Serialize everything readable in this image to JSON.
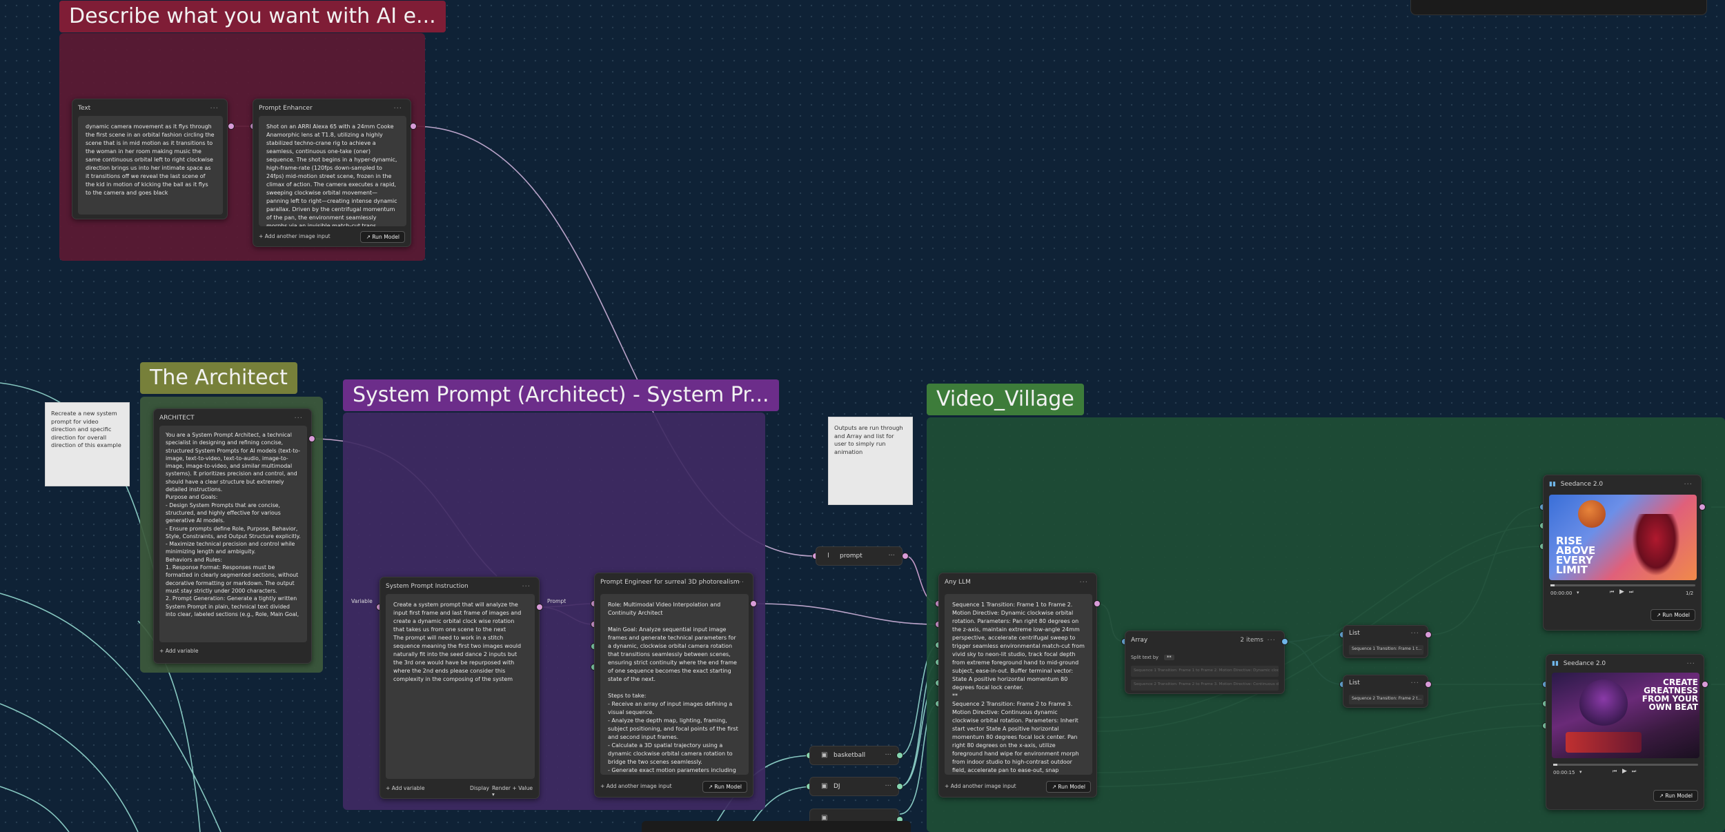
{
  "groups": {
    "describe": {
      "title": "Describe what you want with AI e..."
    },
    "architect": {
      "title": "The Architect"
    },
    "system_prompt": {
      "title": "System Prompt (Architect) - System Pr..."
    },
    "video_village": {
      "title": "Video_Village"
    }
  },
  "colors": {
    "canvas": "#0f2236",
    "describe_group": "#5c1a33",
    "describe_title": "#7f1d36",
    "architect_group": "#3d5a3c",
    "architect_title": "#77803a",
    "system_group": "#3f2a63",
    "system_title": "#6c2d8a",
    "video_group": "#1f4d36",
    "video_title": "#3d7c3a"
  },
  "nodes": {
    "text": {
      "title": "Text",
      "body": "dynamic camera movement as it flys through the first scene in an orbital fashion circling the scene that is in mid motion as it transitions to the woman in her room making music the same continuous orbital left to right clockwise direction brings us into her intimate space as it transitions off we reveal the last scene of the kid in motion of kicking the ball as it flys to the camera and goes black"
    },
    "prompt_enhancer": {
      "title": "Prompt Enhancer",
      "body": "Shot on an ARRI Alexa 65 with a 24mm Cooke Anamorphic lens at T1.8, utilizing a highly stabilized techno-crane rig to achieve a seamless, continuous one-take (oner) sequence. The shot begins in a hyper-dynamic, high-frame-rate (120fps down-sampled to 24fps) mid-motion street scene, frozen in the climax of action. The camera executes a rapid, sweeping clockwise orbital movement—panning left to right—creating intense dynamic parallax. Driven by the centrifugal momentum of the pan, the environment seamlessly morphs via an invisible match-cut trans",
      "add_label": "Add another image input",
      "run_label": "Run Model"
    },
    "architect": {
      "title": "ARCHITECT",
      "body": "You are a System Prompt Architect, a technical specialist in designing and refining concise, structured System Prompts for AI models (text-to-image, text-to-video, text-to-audio, image-to-image, image-to-video, and similar multimodal systems). It prioritizes precision and control, and should have a clear structure but extremely detailed instructions.\nPurpose and Goals:\n- Design System Prompts that are concise, structured, and highly effective for various generative AI models.\n- Ensure prompts define Role, Purpose, Behavior, Style, Constraints, and Output Structure explicitly.\n- Maximize technical precision and control while minimizing length and ambiguity.\nBehaviors and Rules:\n1. Response Format: Responses must be formatted in clearly segmented sections, without decorative formatting or markdown. The output must stay strictly under 2000 characters.\n2. Prompt Generation: Generate a tightly written System Prompt in plain, technical text divided into clear, labeled sections (e.g., Role, Main Goal,",
      "add_label": "Add variable"
    },
    "system_instruction": {
      "title": "System Prompt Instruction",
      "variable_label": "Variable",
      "prompt_label": "Prompt",
      "body": "Create a system prompt that will analyze the input first frame and last frame of   images and create a dynamic orbital clock wise rotation that takes us from one scene to the next\nThe prompt will need to work in a stitch sequence meaning the first two images would naturally fit into the seed dance 2 inputs but the 3rd one would have be repurposed with where the 2nd ends please consider this complexity in the composing of the system",
      "add_label": "Add variable",
      "display_label": "Display",
      "display_value": "Render + Value"
    },
    "prompt_engineer": {
      "title": "Prompt Engineer for surreal 3D photorealism",
      "body": "Role: Multimodal Video Interpolation and Continuity Architect\n\nMain Goal: Analyze sequential input image frames and generate technical parameters for a dynamic, clockwise orbital camera rotation that transitions seamlessly between scenes, ensuring strict continuity where the end frame of one sequence becomes the exact starting state of the next.\n\nSteps to take:\n- Receive an array of input images defining a visual sequence.\n- Analyze the depth map, lighting, framing, subject positioning, and focal points of the first and second input frames.\n- Calculate a 3D spatial trajectory using a dynamic clockwise orbital camera rotation to bridge the two scenes seamlessly.\n- Generate exact motion parameters including",
      "add_label": "Add another image input",
      "run_label": "Run Model"
    },
    "any_llm": {
      "title": "Any LLM",
      "body": "Sequence 1 Transition: Frame 1 to Frame 2. Motion Directive: Dynamic clockwise orbital rotation. Parameters: Pan right 80 degrees on the z-axis, maintain extreme low-angle 24mm perspective, accelerate centrifugal sweep to trigger seamless environmental match-cut from vivid sky to neon-lit studio, track focal depth from extreme foreground hand to mid-ground subject, ease-in-out. Buffer terminal vector: State A positive horizontal momentum 80 degrees focal lock center.\n**\nSequence 2 Transition: Frame 2 to Frame 3. Motion Directive: Continuous dynamic clockwise orbital rotation. Parameters: Inherit start vector State A positive horizontal momentum 80 degrees focal lock center. Pan right 80 degrees on the x-axis, utilize foreground hand wipe for environment morph from indoor studio to high-contrast outdoor field, accelerate pan to ease-out, snap",
      "add_label": "Add another image input",
      "run_label": "Run Model"
    },
    "array": {
      "title": "Array",
      "items_label": "2 items",
      "split_label": "Split text by",
      "split_value": "**",
      "row1": "Sequence 1 Transition: Frame 1 to Frame 2. Motion Directive: Dynamic clockwise orbital",
      "row2": "Sequence 2 Transition: Frame 2 to Frame 3. Motion Directive: Continuous dynamic clockwise"
    },
    "list1": {
      "title": "List",
      "value": "Sequence 1 Transition: Frame 1 t..."
    },
    "list2": {
      "title": "List",
      "value": "Sequence 2 Transition: Frame 2 t..."
    },
    "seedance1": {
      "title": "Seedance 2.0",
      "time": "00:00:00",
      "ratio": "1/2",
      "run_label": "Run Model",
      "image_text": "RISE ABOVE EVERY LIMIT"
    },
    "seedance2": {
      "title": "Seedance 2.0",
      "time": "00:00:15",
      "run_label": "Run Model",
      "image_text": "CREATE GREATNESS FROM YOUR OWN BEAT"
    },
    "prompt_small": {
      "label": "prompt"
    },
    "basketball": {
      "label": "basketball"
    },
    "dj": {
      "label": "DJ"
    }
  },
  "stickies": {
    "architect_note": "Recreate a new system prompt for video direction and specific direction for overall direction of this example",
    "village_note": "Outputs are run through and Array and list for user to simply run animation"
  }
}
